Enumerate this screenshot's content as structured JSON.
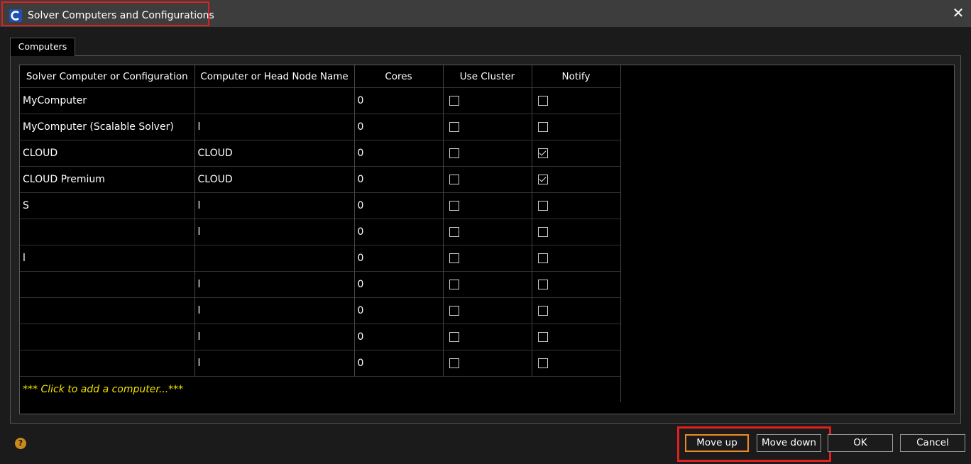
{
  "window": {
    "title": "Solver Computers and Configurations",
    "close_glyph": "✕",
    "accent_color": "#f08a24",
    "highlight_color": "#e02020",
    "add_row_color": "#f0e000"
  },
  "tabs": [
    {
      "label": "Computers"
    }
  ],
  "table": {
    "headers": {
      "name": "Solver Computer or Configuration",
      "host": "Computer or Head Node Name",
      "cores": "Cores",
      "use_cluster": "Use Cluster",
      "notify": "Notify"
    },
    "rows": [
      {
        "name": "MyComputer",
        "host": "",
        "cores": "0",
        "use_cluster": false,
        "notify": false
      },
      {
        "name": "MyComputer (Scalable Solver)",
        "host": "l",
        "cores": "0",
        "use_cluster": false,
        "notify": false
      },
      {
        "name": "CLOUD",
        "host": "CLOUD",
        "cores": "0",
        "use_cluster": false,
        "notify": true
      },
      {
        "name": "CLOUD Premium",
        "host": "CLOUD",
        "cores": "0",
        "use_cluster": false,
        "notify": true
      },
      {
        "name": "S",
        "host": "l",
        "cores": "0",
        "use_cluster": false,
        "notify": false
      },
      {
        "name": "",
        "host": "l",
        "cores": "0",
        "use_cluster": false,
        "notify": false
      },
      {
        "name": "l",
        "host": "",
        "cores": "0",
        "use_cluster": false,
        "notify": false
      },
      {
        "name": "",
        "host": "l",
        "cores": "0",
        "use_cluster": false,
        "notify": false
      },
      {
        "name": "",
        "host": "l",
        "cores": "0",
        "use_cluster": false,
        "notify": false
      },
      {
        "name": "",
        "host": "l",
        "cores": "0",
        "use_cluster": false,
        "notify": false
      },
      {
        "name": "",
        "host": "l",
        "cores": "0",
        "use_cluster": false,
        "notify": false
      }
    ],
    "add_row_label": "*** Click to add a computer...***"
  },
  "footer": {
    "help_glyph": "?",
    "move_up": "Move up",
    "move_down": "Move down",
    "ok": "OK",
    "cancel": "Cancel"
  }
}
